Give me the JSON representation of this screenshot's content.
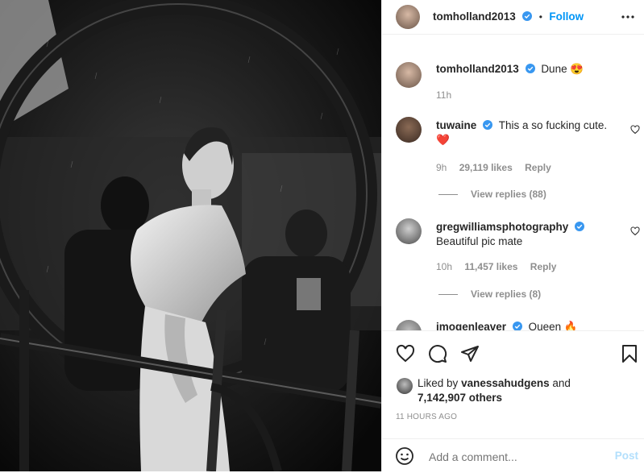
{
  "post": {
    "author": "tomholland2013",
    "follow_label": "Follow",
    "dot": "•"
  },
  "caption": {
    "author": "tomholland2013",
    "text": "Dune",
    "emoji": "😍",
    "time": "11h"
  },
  "comments": [
    {
      "user": "tuwaine",
      "text": "This a so fucking cute.",
      "emoji": "❤️",
      "time": "9h",
      "likes": "29,119 likes",
      "reply_label": "Reply",
      "view_replies": "View replies (88)"
    },
    {
      "user": "gregwilliamsphotography",
      "text": "Beautiful pic mate",
      "time": "10h",
      "likes": "11,457 likes",
      "reply_label": "Reply",
      "view_replies": "View replies (8)"
    },
    {
      "user": "imogenleaver",
      "text": "Queen",
      "emoji": "🔥"
    }
  ],
  "likes": {
    "prefix": "Liked by",
    "user": "vanessahudgens",
    "and": "and",
    "others": "7,142,907 others"
  },
  "post_time": "11 HOURS AGO",
  "add_comment": {
    "placeholder": "Add a comment...",
    "post_label": "Post"
  },
  "colors": {
    "accent": "#0095f6",
    "verified": "#3897f0",
    "muted": "#8e8e8e",
    "heart": "#ed4956"
  },
  "icons": [
    "more-options-icon",
    "heart-icon",
    "comment-icon",
    "share-icon",
    "bookmark-icon",
    "emoji-icon",
    "verified-badge-icon"
  ]
}
